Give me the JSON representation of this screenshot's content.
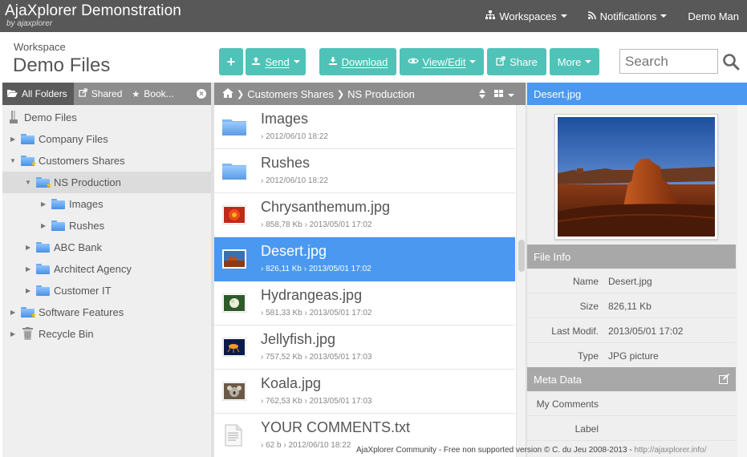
{
  "app": {
    "title": "AjaXplorer Demonstration",
    "subtitle": "by ajaxplorer"
  },
  "topnav": {
    "workspaces": "Workspaces",
    "notifications": "Notifications",
    "user": "Demo Man"
  },
  "workspace": {
    "label": "Workspace",
    "title": "Demo Files"
  },
  "toolbar": {
    "add_label": "+",
    "send_label": "Send",
    "download_label": "Download",
    "view_edit_label": "View/Edit",
    "share_label": "Share",
    "more_label": "More"
  },
  "search": {
    "placeholder": "Search"
  },
  "left_tabs": {
    "all_folders": "All Folders",
    "shared": "Shared",
    "bookmarks": "Book..."
  },
  "tree": {
    "root": "Demo Files",
    "items": [
      {
        "label": "Company Files"
      },
      {
        "label": "Customers Shares"
      },
      {
        "label": "NS Production"
      },
      {
        "label": "Images"
      },
      {
        "label": "Rushes"
      },
      {
        "label": "ABC Bank"
      },
      {
        "label": "Architect Agency"
      },
      {
        "label": "Customer IT"
      },
      {
        "label": "Software Features"
      },
      {
        "label": "Recycle Bin"
      }
    ]
  },
  "breadcrumb": {
    "part1": "Customers Shares",
    "part2": "NS Production"
  },
  "files": [
    {
      "name": "Images",
      "size": "",
      "date": "2012/06/10 18:22"
    },
    {
      "name": "Rushes",
      "size": "",
      "date": "2012/06/10 18:22"
    },
    {
      "name": "Chrysanthemum.jpg",
      "size": "858,78 Kb",
      "date": "2013/05/01 17:02"
    },
    {
      "name": "Desert.jpg",
      "size": "826,11 Kb",
      "date": "2013/05/01 17:02"
    },
    {
      "name": "Hydrangeas.jpg",
      "size": "581,33 Kb",
      "date": "2013/05/01 17:02"
    },
    {
      "name": "Jellyfish.jpg",
      "size": "757,52 Kb",
      "date": "2013/05/01 17:03"
    },
    {
      "name": "Koala.jpg",
      "size": "762,53 Kb",
      "date": "2013/05/01 17:03"
    },
    {
      "name": "YOUR COMMENTS.txt",
      "size": "62 b",
      "date": "2012/06/10 18:22"
    }
  ],
  "details": {
    "title": "Desert.jpg",
    "file_info_header": "File Info",
    "name_key": "Name",
    "name_val": "Desert.jpg",
    "size_key": "Size",
    "size_val": "826,11 Kb",
    "modif_key": "Last Modif.",
    "modif_val": "2013/05/01 17:02",
    "type_key": "Type",
    "type_val": "JPG picture",
    "meta_header": "Meta Data",
    "comments_key": "My Comments",
    "label_key": "Label"
  },
  "footer": {
    "text": "AjaXplorer Community - Free non supported version © C. du Jeu 2008-2013 - ",
    "link": "http://ajaxplorer.info/"
  },
  "colors": {
    "topbar": "#585858",
    "accent_teal": "#4fc3b7",
    "selection_blue": "#4a98f0"
  }
}
